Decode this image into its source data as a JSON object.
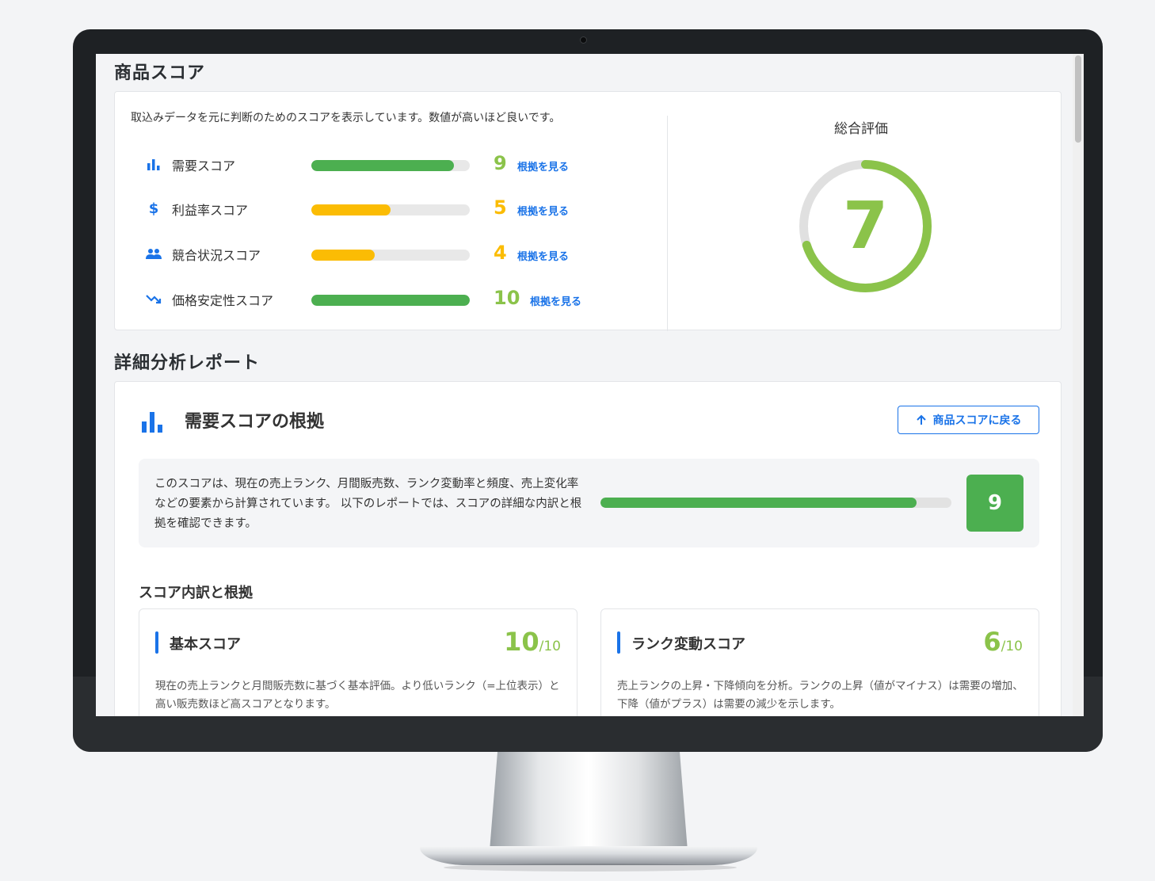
{
  "overview": {
    "section_title": "商品スコア",
    "intro": "取込みデータを元に判断のためのスコアを表示しています。数値が高いほど良いです。",
    "scores": [
      {
        "icon": "bar-chart-icon",
        "label": "需要スコア",
        "value": "9",
        "ratio": 0.9,
        "bar_color": "#4caf50",
        "value_color": "#8bc34a",
        "link": "根拠を見る"
      },
      {
        "icon": "dollar-icon",
        "label": "利益率スコア",
        "value": "5",
        "ratio": 0.5,
        "bar_color": "#fbbc04",
        "value_color": "#fbbc04",
        "link": "根拠を見る"
      },
      {
        "icon": "people-icon",
        "label": "競合状況スコア",
        "value": "4",
        "ratio": 0.4,
        "bar_color": "#fbbc04",
        "value_color": "#fbbc04",
        "link": "根拠を見る"
      },
      {
        "icon": "trending-down-icon",
        "label": "価格安定性スコア",
        "value": "10",
        "ratio": 1.0,
        "bar_color": "#4caf50",
        "value_color": "#8bc34a",
        "link": "根拠を見る"
      }
    ],
    "overall_title": "総合評価",
    "overall_value": "7",
    "overall_ratio": 0.7
  },
  "detail": {
    "section_title": "詳細分析レポート",
    "title": "需要スコアの根拠",
    "back_label": "商品スコアに戻る",
    "summary": "このスコアは、現在の売上ランク、月間販売数、ランク変動率と頻度、売上変化率などの要素から計算されています。 以下のレポートでは、スコアの詳細な内訳と根拠を確認できます。",
    "score": "9",
    "score_ratio": 0.9,
    "breakdown_title": "スコア内訳と根拠",
    "items": [
      {
        "title": "基本スコア",
        "score": "10",
        "max": "/10",
        "desc": "現在の売上ランクと月間販売数に基づく基本評価。より低いランク（=上位表示）と高い販売数ほど高スコアとなります。"
      },
      {
        "title": "ランク変動スコア",
        "score": "6",
        "max": "/10",
        "desc": "売上ランクの上昇・下降傾向を分析。ランクの上昇（値がマイナス）は需要の増加、下降（値がプラス）は需要の減少を示します。"
      }
    ]
  }
}
